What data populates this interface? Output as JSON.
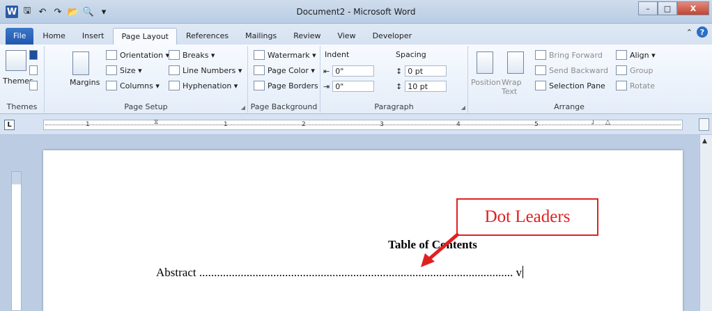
{
  "window": {
    "title": "Document2 - Microsoft Word"
  },
  "tabs": [
    "File",
    "Home",
    "Insert",
    "Page Layout",
    "References",
    "Mailings",
    "Review",
    "View",
    "Developer"
  ],
  "ribbon": {
    "themes": {
      "label": "Themes",
      "group": "Themes"
    },
    "page_setup": {
      "margins": "Margins",
      "orientation": "Orientation ▾",
      "size": "Size ▾",
      "columns": "Columns ▾",
      "breaks": "Breaks ▾",
      "line_numbers": "Line Numbers ▾",
      "hyphenation": "Hyphenation ▾",
      "group": "Page Setup"
    },
    "page_background": {
      "watermark": "Watermark ▾",
      "page_color": "Page Color ▾",
      "page_borders": "Page Borders",
      "group": "Page Background"
    },
    "paragraph": {
      "indent": "Indent",
      "spacing": "Spacing",
      "indent_left": "0\"",
      "indent_right": "0\"",
      "spacing_before": "0 pt",
      "spacing_after": "10 pt",
      "group": "Paragraph"
    },
    "arrange": {
      "position": "Position",
      "wrap_text": "Wrap Text",
      "bring_forward": "Bring Forward",
      "send_backward": "Send Backward",
      "selection_pane": "Selection Pane",
      "align": "Align ▾",
      "group_btn": "Group",
      "rotate": "Rotate",
      "group": "Arrange"
    }
  },
  "ruler": {
    "numbers": [
      "1",
      "1",
      "2",
      "3",
      "4",
      "5"
    ]
  },
  "document": {
    "toc_title": "Table of Contents",
    "entry_label": "Abstract",
    "leader": "..........................................................................................................",
    "page_num": "v"
  },
  "annotation": {
    "callout": "Dot Leaders",
    "color": "#e02020"
  }
}
